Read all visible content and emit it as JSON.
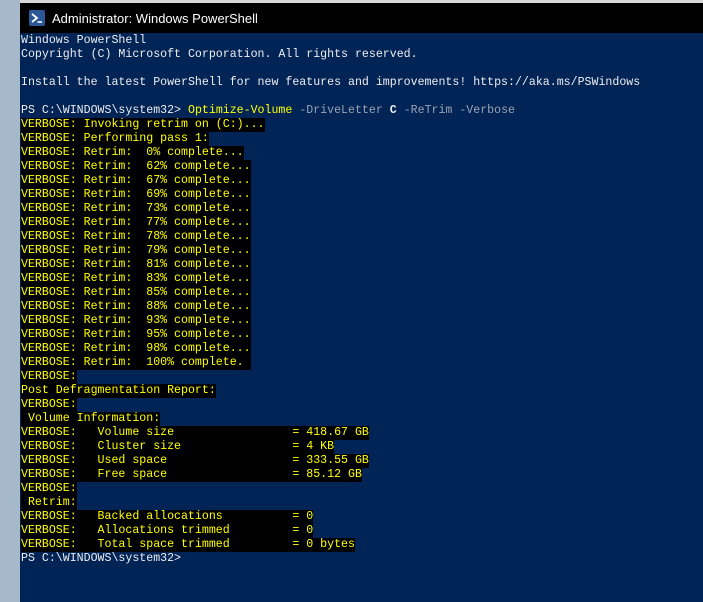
{
  "window": {
    "title": "Administrator: Windows PowerShell",
    "icon": "powershell-icon"
  },
  "console": {
    "banner": {
      "line1": "Windows PowerShell",
      "line2": "Copyright (C) Microsoft Corporation. All rights reserved.",
      "line3": "Install the latest PowerShell for new features and improvements! https://aka.ms/PSWindows"
    },
    "command": {
      "prompt": "PS C:\\WINDOWS\\system32> ",
      "cmdlet": "Optimize-Volume",
      "param1": " -DriveLetter ",
      "arg1": "C",
      "param2": " -ReTrim -Verbose"
    },
    "verbose_lines": [
      "VERBOSE: Invoking retrim on (C:)...",
      "VERBOSE: Performing pass 1:",
      "VERBOSE: Retrim:  0% complete...",
      "VERBOSE: Retrim:  62% complete...",
      "VERBOSE: Retrim:  67% complete...",
      "VERBOSE: Retrim:  69% complete...",
      "VERBOSE: Retrim:  73% complete...",
      "VERBOSE: Retrim:  77% complete...",
      "VERBOSE: Retrim:  78% complete...",
      "VERBOSE: Retrim:  79% complete...",
      "VERBOSE: Retrim:  81% complete...",
      "VERBOSE: Retrim:  83% complete...",
      "VERBOSE: Retrim:  85% complete...",
      "VERBOSE: Retrim:  88% complete...",
      "VERBOSE: Retrim:  93% complete...",
      "VERBOSE: Retrim:  95% complete...",
      "VERBOSE: Retrim:  98% complete...",
      "VERBOSE: Retrim:  100% complete. ",
      "VERBOSE:",
      "Post Defragmentation Report:",
      "VERBOSE:",
      " Volume Information:",
      "VERBOSE:   Volume size                 = 418.67 GB",
      "VERBOSE:   Cluster size                = 4 KB",
      "VERBOSE:   Used space                  = 333.55 GB",
      "VERBOSE:   Free space                  = 85.12 GB",
      "VERBOSE:",
      " Retrim:",
      "VERBOSE:   Backed allocations          = 0",
      "VERBOSE:   Allocations trimmed         = 0",
      "VERBOSE:   Total space trimmed         = 0 bytes"
    ],
    "final_prompt": "PS C:\\WINDOWS\\system32>"
  }
}
